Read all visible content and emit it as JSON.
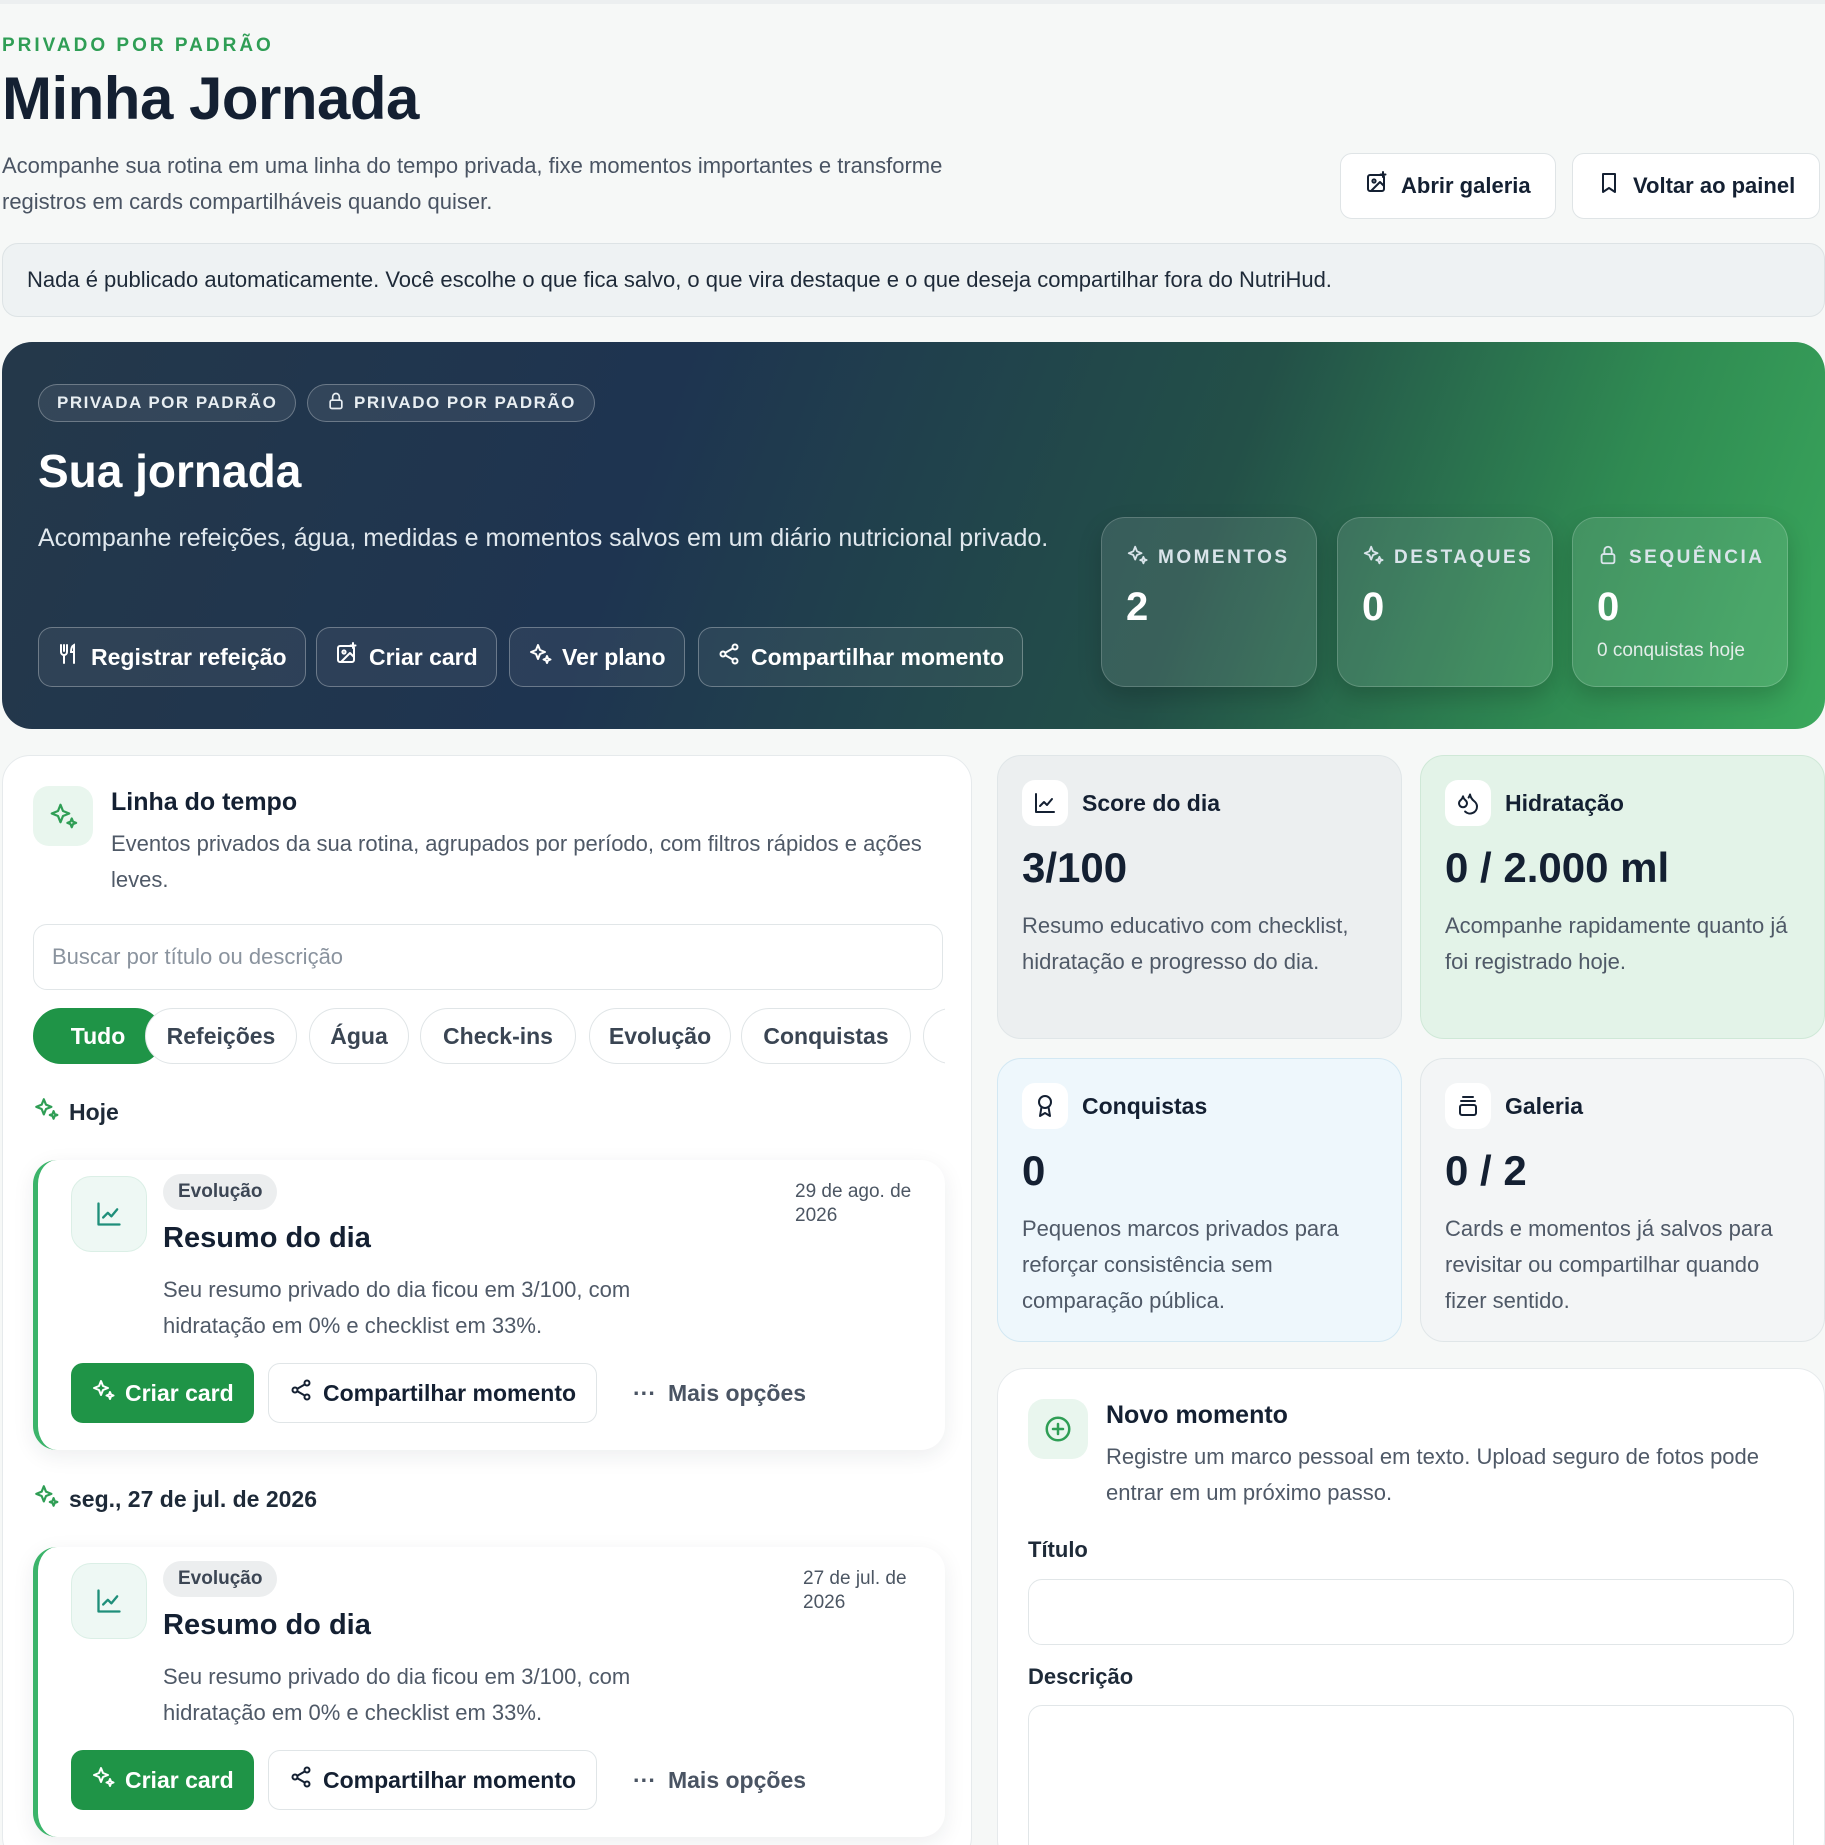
{
  "header": {
    "eyebrow": "PRIVADO POR PADRÃO",
    "title": "Minha Jornada",
    "subtitle": "Acompanhe sua rotina em uma linha do tempo privada, fixe momentos importantes e transforme registros em cards compartilháveis quando quiser.",
    "open_gallery": "Abrir galeria",
    "back_panel": "Voltar ao painel"
  },
  "notice": "Nada é publicado automaticamente. Você escolhe o que fica salvo, o que vira destaque e o que deseja compartilhar fora do NutriHud.",
  "hero": {
    "pill1": "PRIVADA POR PADRÃO",
    "pill2": "PRIVADO POR PADRÃO",
    "title": "Sua jornada",
    "subtitle": "Acompanhe refeições, água, medidas e momentos salvos em um diário nutricional privado.",
    "buttons": [
      "Registrar refeição",
      "Criar card",
      "Ver plano",
      "Compartilhar momento"
    ],
    "stats": [
      {
        "label": "MOMENTOS",
        "value": "2",
        "note": ""
      },
      {
        "label": "DESTAQUES",
        "value": "0",
        "note": ""
      },
      {
        "label": "SEQUÊNCIA",
        "value": "0",
        "note": "0 conquistas hoje"
      }
    ]
  },
  "timeline": {
    "title": "Linha do tempo",
    "subtitle": "Eventos privados da sua rotina, agrupados por período, com filtros rápidos e ações leves.",
    "search_placeholder": "Buscar por título ou descrição",
    "filters": [
      "Tudo",
      "Refeições",
      "Água",
      "Check-ins",
      "Evolução",
      "Conquistas"
    ],
    "groups": [
      {
        "label": "Hoje",
        "event": {
          "tag": "Evolução",
          "title": "Resumo do dia",
          "date": "29 de ago. de 2026",
          "desc": "Seu resumo privado do dia ficou em 3/100, com hidratação em 0% e checklist em 33%.",
          "primary": "Criar card",
          "share": "Compartilhar momento",
          "more": "Mais opções"
        }
      },
      {
        "label": "seg., 27 de jul. de 2026",
        "event": {
          "tag": "Evolução",
          "title": "Resumo do dia",
          "date": "27 de jul. de 2026",
          "desc": "Seu resumo privado do dia ficou em 3/100, com hidratação em 0% e checklist em 33%.",
          "primary": "Criar card",
          "share": "Compartilhar momento",
          "more": "Mais opções"
        }
      }
    ]
  },
  "cards": {
    "score": {
      "title": "Score do dia",
      "value": "3/100",
      "desc": "Resumo educativo com checklist, hidratação e progresso do dia."
    },
    "hydration": {
      "title": "Hidratação",
      "value": "0 / 2.000 ml",
      "desc": "Acompanhe rapidamente quanto já foi registrado hoje."
    },
    "achievements": {
      "title": "Conquistas",
      "value": "0",
      "desc": "Pequenos marcos privados para reforçar consistência sem comparação pública."
    },
    "gallery": {
      "title": "Galeria",
      "value": "0 / 2",
      "desc": "Cards e momentos já salvos para revisitar ou compartilhar quando fizer sentido."
    }
  },
  "new_moment": {
    "title": "Novo momento",
    "subtitle": "Registre um marco pessoal em texto. Upload seguro de fotos pode entrar em um próximo passo.",
    "title_label": "Título",
    "desc_label": "Descrição"
  },
  "colors": {
    "accent": "#1f9447",
    "text": "#142032"
  }
}
